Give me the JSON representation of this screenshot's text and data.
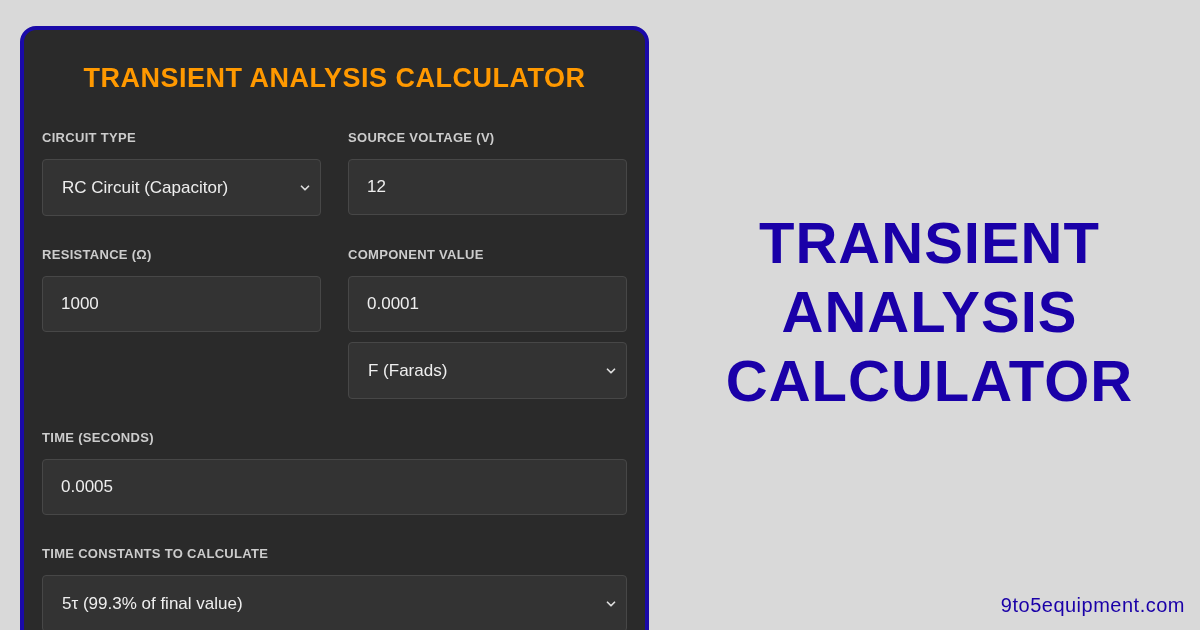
{
  "calculator": {
    "title": "TRANSIENT ANALYSIS CALCULATOR",
    "rows": [
      {
        "fields": [
          {
            "label": "CIRCUIT TYPE",
            "controls": [
              {
                "kind": "select",
                "value": "RC Circuit (Capacitor)"
              }
            ]
          },
          {
            "label": "SOURCE VOLTAGE (V)",
            "controls": [
              {
                "kind": "input",
                "value": "12"
              }
            ]
          }
        ]
      },
      {
        "fields": [
          {
            "label": "RESISTANCE (Ω)",
            "controls": [
              {
                "kind": "input",
                "value": "1000"
              }
            ]
          },
          {
            "label": "COMPONENT VALUE",
            "controls": [
              {
                "kind": "input",
                "value": "0.0001"
              },
              {
                "kind": "select",
                "value": "F (Farads)"
              }
            ]
          }
        ]
      },
      {
        "fields": [
          {
            "label": "TIME (SECONDS)",
            "controls": [
              {
                "kind": "input",
                "value": "0.0005"
              }
            ]
          }
        ]
      },
      {
        "fields": [
          {
            "label": "TIME CONSTANTS TO CALCULATE",
            "controls": [
              {
                "kind": "select",
                "value": "5τ (99.3% of final value)"
              }
            ]
          }
        ]
      }
    ]
  },
  "headline": [
    "TRANSIENT",
    "ANALYSIS",
    "CALCULATOR"
  ],
  "site": "9to5equipment.com"
}
